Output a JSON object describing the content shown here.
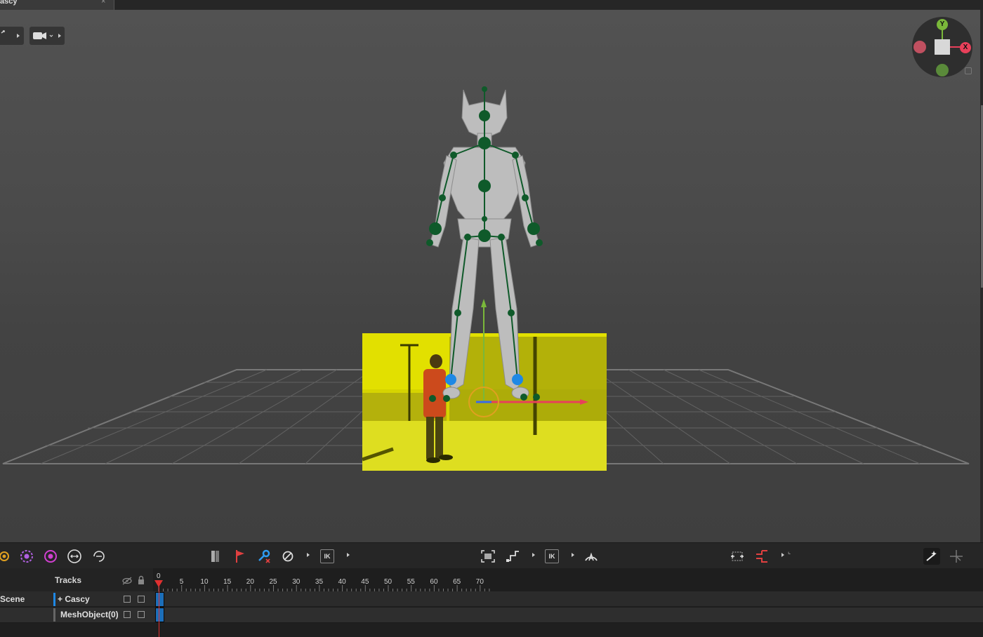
{
  "window": {
    "tab_title": "ascy",
    "close_glyph": "×"
  },
  "viewport": {
    "camera_menu": "camera-icon",
    "gizmo": {
      "y_label": "Y",
      "x_label": "X"
    },
    "background_image_colors": {
      "tint": "#d8d800",
      "person": "#c8401c"
    },
    "accent": {
      "x_axis": "#e8405a",
      "y_axis": "#7ab83a",
      "z_axis": "#3a6ae8",
      "bone": "#0f5a2a",
      "selection": "#e0a020"
    }
  },
  "toolbar": {
    "left_icons": [
      "pivot-sun-icon",
      "pivot-purple-icon",
      "pivot-magenta-icon",
      "rotate-x-icon",
      "rotate-loop-icon"
    ],
    "mid_icons": [
      "pin-icon",
      "flag-icon",
      "key-remove-icon",
      "disable-icon"
    ],
    "ik1": "IK",
    "ik2": "IK",
    "right_icons": [
      "frame-all-icon",
      "step-curve-icon",
      "auto-ik-icon",
      "mirror-icon",
      "swap-icon",
      "smart-pose-icon",
      "axis-icon"
    ]
  },
  "timeline": {
    "tracks_label": "Tracks",
    "ruler_ticks": [
      "0",
      "5",
      "10",
      "15",
      "20",
      "25",
      "30",
      "35",
      "40",
      "45",
      "50",
      "55",
      "60",
      "65",
      "70"
    ],
    "scene_label": "Scene",
    "rows": [
      {
        "name": "+ Cascy"
      },
      {
        "name": "MeshObject(0)"
      }
    ],
    "current_frame": 0
  }
}
